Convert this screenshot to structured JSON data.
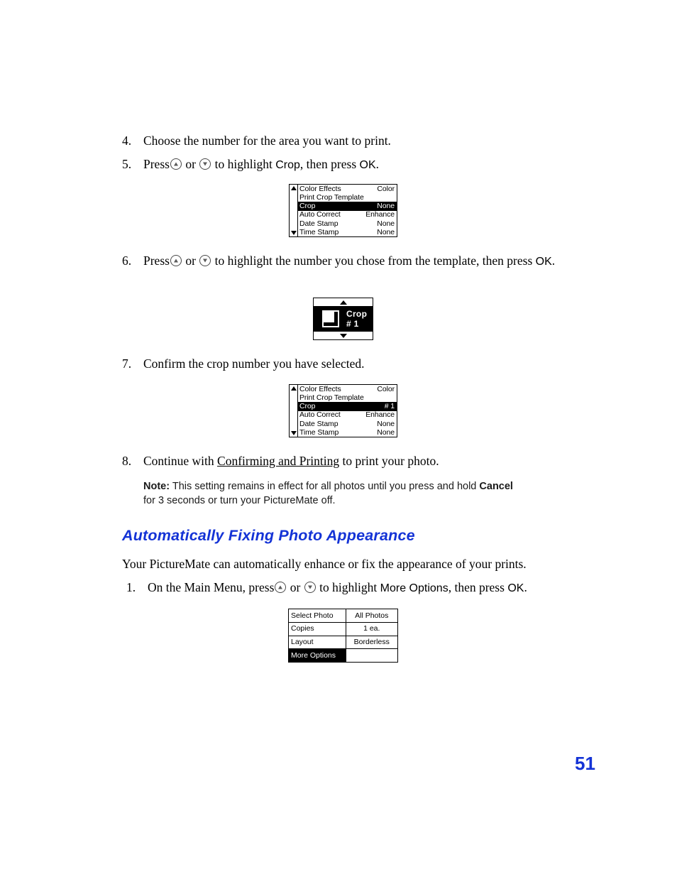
{
  "document": {
    "page_number": "51"
  },
  "steps": {
    "s4": {
      "num": "4.",
      "text": "Choose the number for the area you want to print."
    },
    "s5": {
      "num": "5.",
      "pre": "Press",
      "mid": "or",
      "post": "to highlight",
      "target": "Crop",
      "tail": ", then press",
      "confirm": "OK",
      "end": "."
    },
    "s6": {
      "num": "6.",
      "pre": "Press",
      "mid": "or",
      "post": "to highlight the number you chose from the template, then press",
      "confirm": "OK",
      "end": "."
    },
    "s7": {
      "num": "7.",
      "text": "Confirm the crop number you have selected."
    },
    "s8": {
      "num": "8.",
      "pre": "Continue with",
      "link": "Confirming and Printing",
      "post": "to print your photo."
    },
    "s1b": {
      "num": "1.",
      "pre": "On the Main Menu, press",
      "mid": "or",
      "post": "to highlight",
      "target": "More Options",
      "tail": ", then press",
      "confirm": "OK",
      "end": "."
    }
  },
  "note": {
    "label": "Note:",
    "line1_a": "This setting remains in effect for all photos until you press and hold",
    "line1_b": "Cancel",
    "line2": "for 3 seconds or turn your PictureMate off."
  },
  "section": {
    "heading": "Automatically Fixing Photo Appearance",
    "paragraph": "Your PictureMate can automatically enhance or fix the appearance of your prints."
  },
  "lcd_settings_1": {
    "rows": [
      {
        "label": "Color Effects",
        "value": "Color",
        "selected": false
      },
      {
        "label": "Print Crop Template",
        "value": "",
        "selected": false
      },
      {
        "label": "Crop",
        "value": "None",
        "selected": true
      },
      {
        "label": "Auto Correct",
        "value": "Enhance",
        "selected": false
      },
      {
        "label": "Date Stamp",
        "value": "None",
        "selected": false
      },
      {
        "label": "Time Stamp",
        "value": "None",
        "selected": false
      }
    ]
  },
  "lcd_settings_2": {
    "rows": [
      {
        "label": "Color Effects",
        "value": "Color",
        "selected": false
      },
      {
        "label": "Print Crop Template",
        "value": "",
        "selected": false
      },
      {
        "label": "Crop",
        "value": "# 1",
        "selected": true
      },
      {
        "label": "Auto Correct",
        "value": "Enhance",
        "selected": false
      },
      {
        "label": "Date Stamp",
        "value": "None",
        "selected": false
      },
      {
        "label": "Time Stamp",
        "value": "None",
        "selected": false
      }
    ]
  },
  "lcd_crop": {
    "text": "Crop # 1"
  },
  "lcd_main_menu": {
    "rows": [
      {
        "label": "Select Photo",
        "value": "All Photos",
        "selected": false
      },
      {
        "label": "Copies",
        "value": "1 ea.",
        "selected": false
      },
      {
        "label": "Layout",
        "value": "Borderless",
        "selected": false
      },
      {
        "label": "More Options",
        "value": "",
        "selected": true
      }
    ]
  }
}
